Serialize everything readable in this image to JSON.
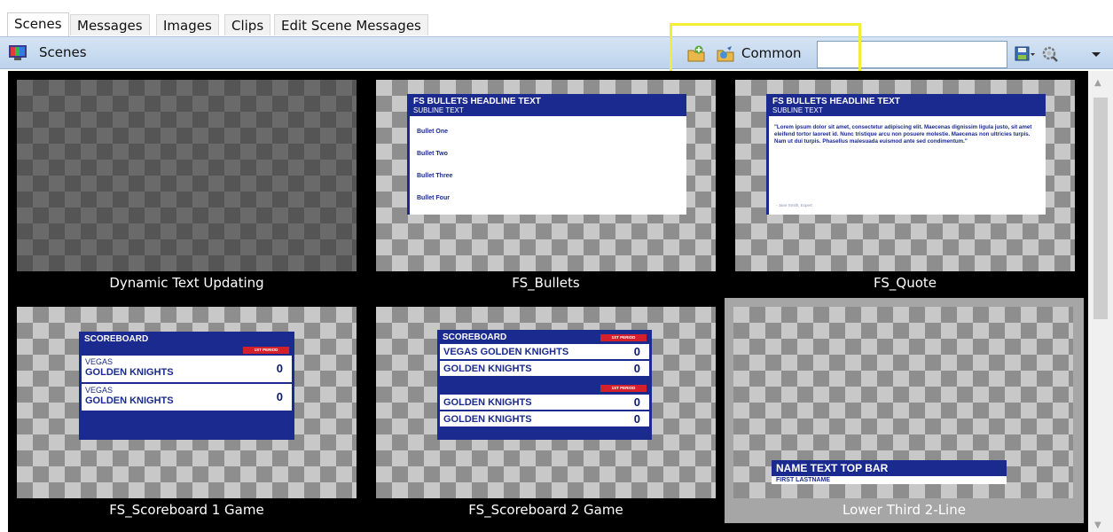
{
  "tabs": [
    {
      "label": "Scenes",
      "active": true
    },
    {
      "label": "Messages"
    },
    {
      "label": "Images"
    },
    {
      "label": "Clips"
    },
    {
      "label": "Edit Scene Messages"
    }
  ],
  "header": {
    "title": "Scenes",
    "filter_label": "Common",
    "search_value": ""
  },
  "scenes": [
    {
      "name": "Dynamic Text Updating"
    },
    {
      "name": "FS_Bullets",
      "headline": "FS BULLETS HEADLINE TEXT",
      "subline": "SUBLINE TEXT",
      "bullets": [
        "Bullet One",
        "Bullet Two",
        "Bullet Three",
        "Bullet Four"
      ]
    },
    {
      "name": "FS_Quote",
      "headline": "FS BULLETS HEADLINE TEXT",
      "subline": "SUBLINE TEXT",
      "quote": "\"Lorem ipsum dolor sit amet, consectetur adipiscing elit. Maecenas dignissim ligula justo, sit amet eleifend tortor laoreet id. Nunc tristique arcu non posuere molestie. Maecenas non ultricies turpis. Nam ut dui turpis. Phasellus malesuada euismod ante sed condimentum.\"",
      "attribution": "- Jane Smith, Expert"
    },
    {
      "name": "FS_Scoreboard 1 Game",
      "title": "SCOREBOARD",
      "period": "1ST PERIOD",
      "teams": [
        {
          "line1": "VEGAS",
          "line2": "GOLDEN KNIGHTS",
          "score": "0"
        },
        {
          "line1": "VEGAS",
          "line2": "GOLDEN KNIGHTS",
          "score": "0"
        }
      ]
    },
    {
      "name": "FS_Scoreboard 2 Game",
      "title": "SCOREBOARD",
      "period1": "1ST PERIOD",
      "period2": "1ST PERIOD",
      "rows": [
        {
          "team": "VEGAS GOLDEN KNIGHTS",
          "score": "0"
        },
        {
          "team": "GOLDEN KNIGHTS",
          "score": "0"
        },
        {
          "team": "GOLDEN KNIGHTS",
          "score": "0"
        },
        {
          "team": "GOLDEN KNIGHTS",
          "score": "0"
        }
      ]
    },
    {
      "name": "Lower Third 2-Line",
      "selected": true,
      "top_bar": "NAME TEXT TOP BAR",
      "bottom_bar": "FIRST LASTNAME"
    }
  ],
  "icons": {
    "scenes": "scenes-color-icon",
    "add": "add-folder-icon",
    "edit": "edit-folder-icon",
    "save": "save-dropdown-icon",
    "settings": "settings-search-icon",
    "menu": "dropdown-arrow-icon"
  },
  "colors": {
    "brand_blue": "#1a2a8f",
    "period_red": "#d3202a",
    "highlight_yellow": "#f2ee33",
    "grid_background": "#000000",
    "selected_cell": "#a6a6a6"
  }
}
